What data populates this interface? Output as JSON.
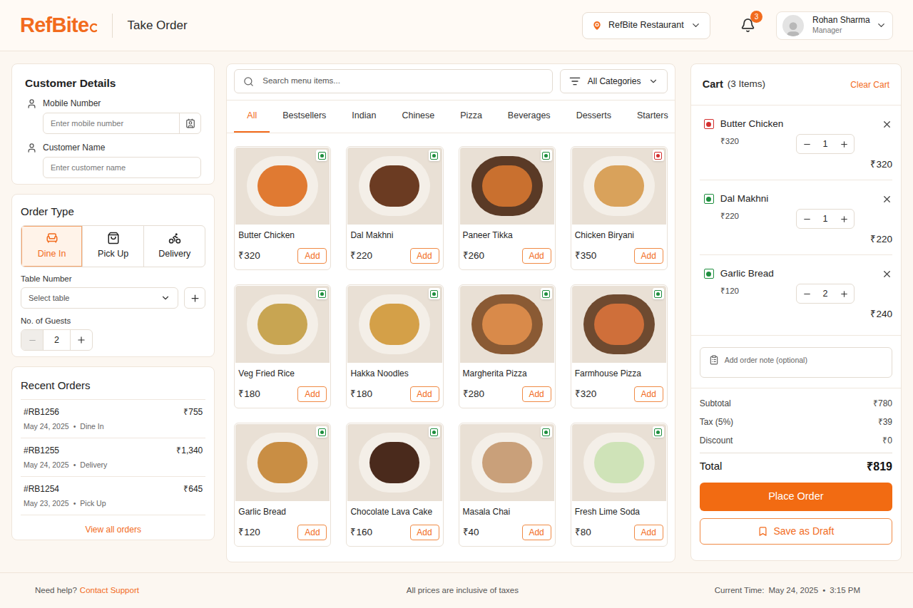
{
  "header": {
    "logo": "RefBite",
    "title": "Take Order",
    "location": "RefBite Restaurant",
    "notifications": "3",
    "user": {
      "name": "Rohan Sharma",
      "role": "Manager"
    }
  },
  "customer": {
    "title": "Customer Details",
    "fields": [
      {
        "label": "Mobile Number",
        "placeholder": "Enter mobile number",
        "contact_button": true
      },
      {
        "label": "Customer Name",
        "placeholder": "Enter customer name",
        "contact_button": false
      }
    ]
  },
  "order_type": {
    "title": "Order Type",
    "options": [
      {
        "label": "Dine In",
        "selected": true
      },
      {
        "label": "Pick Up",
        "selected": false
      },
      {
        "label": "Delivery",
        "selected": false
      }
    ],
    "table": {
      "label": "Table Number",
      "placeholder": "Select table"
    },
    "guests": {
      "label": "No. of Guests",
      "value": "2",
      "minus_disabled": true
    }
  },
  "recent_orders": {
    "title": "Recent Orders",
    "separator": "•",
    "orders": [
      {
        "id": "#RB1256",
        "amount": "₹755",
        "date": "May 24, 2025",
        "type": "Dine In"
      },
      {
        "id": "#RB1255",
        "amount": "₹1,340",
        "date": "May 24, 2025",
        "type": "Delivery"
      },
      {
        "id": "#RB1254",
        "amount": "₹645",
        "date": "May 23, 2025",
        "type": "Pick Up"
      }
    ],
    "link": "View all orders"
  },
  "menu": {
    "search_placeholder": "Search menu items...",
    "category": "All Categories",
    "add_label": "Add",
    "tabs": [
      {
        "label": "All",
        "selected": true
      },
      {
        "label": "Bestsellers",
        "selected": false
      },
      {
        "label": "Indian",
        "selected": false
      },
      {
        "label": "Chinese",
        "selected": false
      },
      {
        "label": "Pizza",
        "selected": false
      },
      {
        "label": "Beverages",
        "selected": false
      },
      {
        "label": "Desserts",
        "selected": false
      },
      {
        "label": "Starters",
        "selected": false
      }
    ],
    "items": [
      {
        "name": "Butter Chicken",
        "price": "₹320",
        "veg": true
      },
      {
        "name": "Dal Makhni",
        "price": "₹220",
        "veg": true
      },
      {
        "name": "Paneer Tikka",
        "price": "₹260",
        "veg": true
      },
      {
        "name": "Chicken Biryani",
        "price": "₹350",
        "veg": false
      },
      {
        "name": "Veg Fried Rice",
        "price": "₹180",
        "veg": true
      },
      {
        "name": "Hakka Noodles",
        "price": "₹180",
        "veg": true
      },
      {
        "name": "Margherita Pizza",
        "price": "₹280",
        "veg": true
      },
      {
        "name": "Farmhouse Pizza",
        "price": "₹320",
        "veg": true
      },
      {
        "name": "Garlic Bread",
        "price": "₹120",
        "veg": true
      },
      {
        "name": "Chocolate Lava Cake",
        "price": "₹160",
        "veg": true
      },
      {
        "name": "Masala Chai",
        "price": "₹40",
        "veg": true
      },
      {
        "name": "Fresh Lime Soda",
        "price": "₹80",
        "veg": true
      }
    ]
  },
  "cart": {
    "title": "Cart",
    "count": "(3 Items)",
    "clear": "Clear Cart",
    "items": [
      {
        "name": "Butter Chicken",
        "price": "₹320",
        "qty": "1",
        "total": "₹320",
        "veg": false
      },
      {
        "name": "Dal Makhni",
        "price": "₹220",
        "qty": "1",
        "total": "₹220",
        "veg": true
      },
      {
        "name": "Garlic Bread",
        "price": "₹120",
        "qty": "2",
        "total": "₹240",
        "veg": true
      }
    ],
    "note_placeholder": "Add order note (optional)",
    "summary": [
      {
        "label": "Subtotal",
        "value": "₹780"
      },
      {
        "label": "Tax (5%)",
        "value": "₹39"
      },
      {
        "label": "Discount",
        "value": "₹0"
      }
    ],
    "total": {
      "label": "Total",
      "value": "₹819"
    },
    "place_order": "Place Order",
    "save_draft": "Save as Draft"
  },
  "footer": {
    "help": "Need help?",
    "support": "Contact Support",
    "note": "All prices are inclusive of taxes",
    "time_label": "Current Time:",
    "date": "May 24, 2025",
    "separator": "•",
    "time": "3:15 PM"
  }
}
